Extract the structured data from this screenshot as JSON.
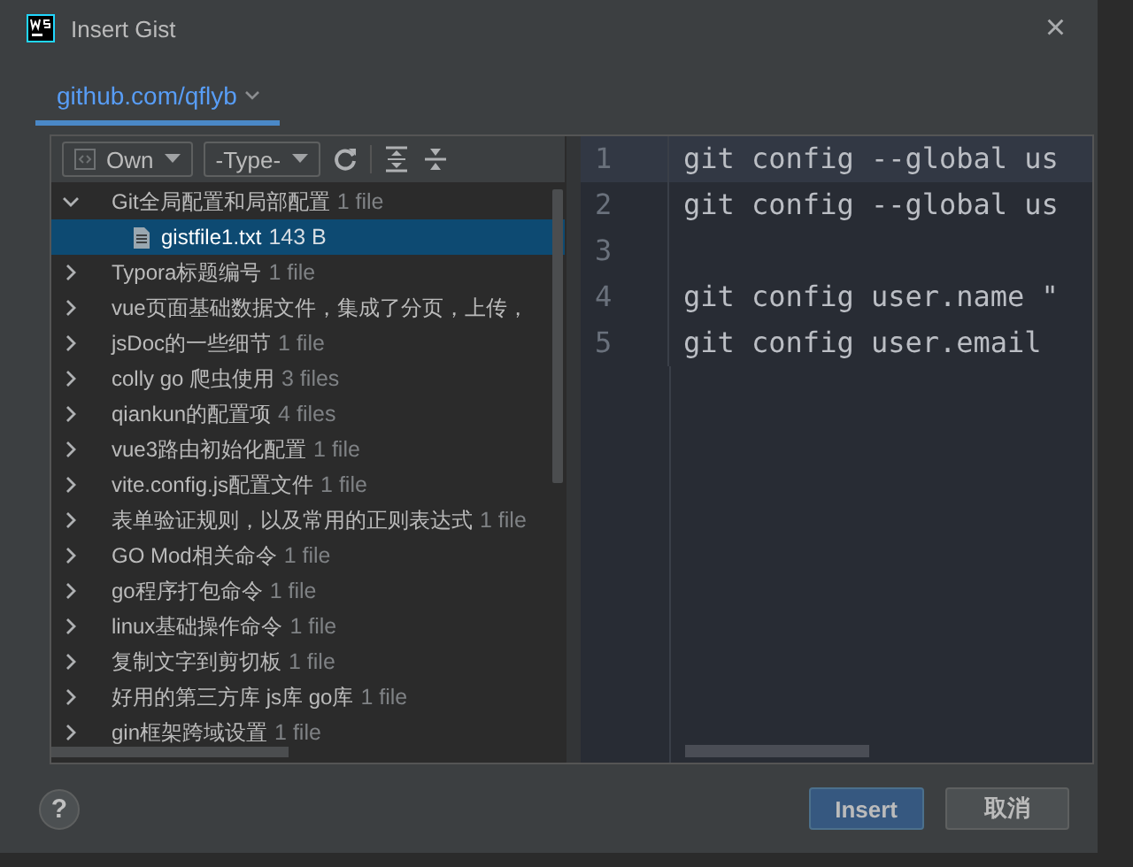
{
  "window": {
    "title": "Insert Gist",
    "close": "×"
  },
  "account_tab": {
    "label": "github.com/qflyb",
    "selected": true
  },
  "filters": [
    {
      "label": "Own",
      "kind": "owner"
    },
    {
      "label": "-Type-",
      "kind": "type"
    }
  ],
  "gists": [
    {
      "name": "Git全局配置和局部配置",
      "count": "1 file",
      "expanded": true,
      "selected": false,
      "children": [
        {
          "name": "gistfile1.txt",
          "size": "143 B",
          "selected": true
        }
      ]
    },
    {
      "name": "Typora标题编号",
      "count": "1 file",
      "expanded": false,
      "selected": false
    },
    {
      "name": "vue页面基础数据文件，集成了分页，上传，",
      "expanded": false,
      "selected": false
    },
    {
      "name": "jsDoc的一些细节",
      "count": "1 file",
      "expanded": false,
      "selected": false
    },
    {
      "name": "colly go 爬虫使用",
      "count": "3 files",
      "expanded": false,
      "selected": false
    },
    {
      "name": "qiankun的配置项",
      "count": "4 files",
      "expanded": false,
      "selected": false
    },
    {
      "name": "vue3路由初始化配置",
      "count": "1 file",
      "expanded": false,
      "selected": false
    },
    {
      "name": "vite.config.js配置文件",
      "count": "1 file",
      "expanded": false,
      "selected": false
    },
    {
      "name": "表单验证规则，以及常用的正则表达式",
      "count": "1 file",
      "expanded": false,
      "selected": false
    },
    {
      "name": "GO Mod相关命令",
      "count": "1 file",
      "expanded": false,
      "selected": false
    },
    {
      "name": "go程序打包命令",
      "count": "1 file",
      "expanded": false,
      "selected": false
    },
    {
      "name": "linux基础操作命令",
      "count": "1 file",
      "expanded": false,
      "selected": false
    },
    {
      "name": "复制文字到剪切板",
      "count": "1 file",
      "expanded": false,
      "selected": false
    },
    {
      "name": "好用的第三方库 js库 go库",
      "count": "1 file",
      "expanded": false,
      "selected": false
    },
    {
      "name": "gin框架跨域设置",
      "count": "1 file",
      "expanded": false,
      "selected": false
    }
  ],
  "code_lines": [
    {
      "number": "1",
      "text": "git config --global us",
      "current": true
    },
    {
      "number": "2",
      "text": "git config --global us",
      "current": false
    },
    {
      "number": "3",
      "current": false
    },
    {
      "number": "4",
      "text": "git config user.name \"",
      "current": false
    },
    {
      "number": "5",
      "text": "git config user.email",
      "current": false
    }
  ],
  "help_button": "?",
  "buttons": [
    {
      "label": "Insert",
      "kind": "primary"
    },
    {
      "label": "取消",
      "kind": "secondary"
    }
  ]
}
